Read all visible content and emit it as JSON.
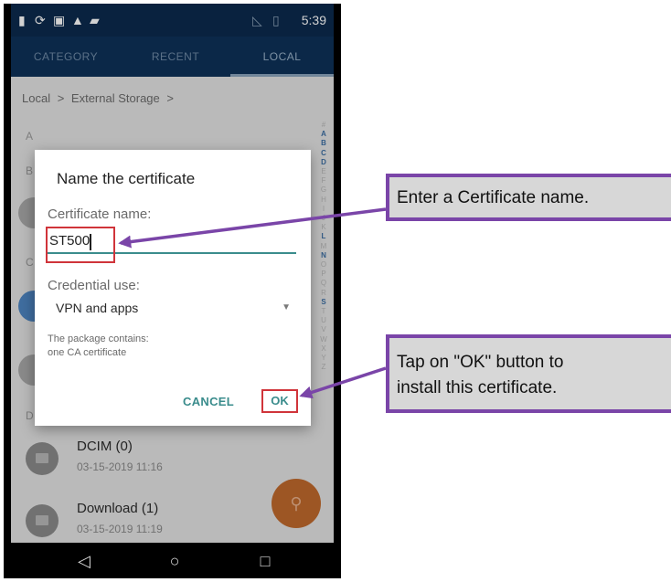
{
  "status_bar": {
    "time": "5:39",
    "icons": [
      "battery-saver-icon",
      "sync-icon",
      "image-icon",
      "warning-icon",
      "sd-card-icon",
      "no-signal-icon",
      "battery-icon"
    ]
  },
  "tabs": [
    {
      "label": "CATEGORY",
      "active": false
    },
    {
      "label": "RECENT",
      "active": false
    },
    {
      "label": "LOCAL",
      "active": true
    }
  ],
  "breadcrumb": {
    "root": "Local",
    "sep1": ">",
    "current": "External Storage",
    "sep2": ">"
  },
  "section_letters": [
    "A",
    "B",
    "C",
    "D"
  ],
  "alpha_index": [
    "#",
    "A",
    "B",
    "C",
    "D",
    "E",
    "F",
    "G",
    "H",
    "I",
    "J",
    "K",
    "L",
    "M",
    "N",
    "O",
    "P",
    "Q",
    "R",
    "S",
    "T",
    "U",
    "V",
    "W",
    "X",
    "Y",
    "Z"
  ],
  "alpha_highlight": [
    "A",
    "B",
    "C",
    "D",
    "L",
    "N",
    "S"
  ],
  "folders": [
    {
      "name": "DCIM (0)",
      "date": "03-15-2019 11:16"
    },
    {
      "name": "Download (1)",
      "date": "03-15-2019 11:19"
    }
  ],
  "fab": {
    "icon": "search-icon"
  },
  "dialog": {
    "title": "Name the certificate",
    "name_label": "Certificate name:",
    "name_value": "ST500",
    "use_label": "Credential use:",
    "use_value": "VPN and apps",
    "package_line1": "The package contains:",
    "package_line2": "one CA certificate",
    "cancel_label": "CANCEL",
    "ok_label": "OK"
  },
  "callouts": {
    "enter_name": "Enter a Certificate name.",
    "tap_ok_line1": "Tap on \"OK\" button to",
    "tap_ok_line2": "install this certificate."
  },
  "colors": {
    "status_bar": "#0b2a4e",
    "tab_bar": "#0e3158",
    "accent_teal": "#3a8c8c",
    "highlight_red": "#d0343a",
    "callout_border": "#7a45a8",
    "fab": "#c0692c"
  }
}
